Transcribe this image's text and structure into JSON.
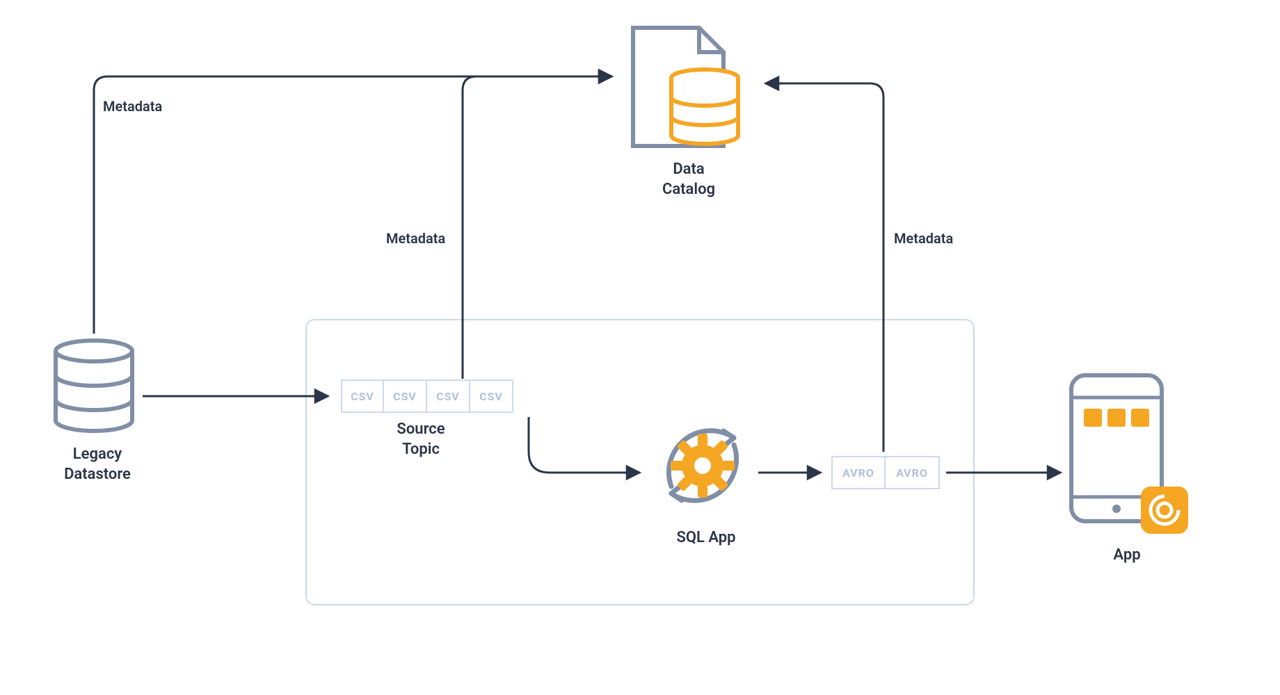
{
  "nodes": {
    "legacy_datastore": {
      "label_line1": "Legacy",
      "label_line2": "Datastore"
    },
    "data_catalog": {
      "label_line1": "Data",
      "label_line2": "Catalog"
    },
    "source_topic": {
      "label_line1": "Source",
      "label_line2": "Topic"
    },
    "sql_app": {
      "label": "SQL App"
    },
    "app": {
      "label": "App"
    }
  },
  "blocks": {
    "csv": {
      "cell": "CSV",
      "count": 4
    },
    "avro": {
      "cell": "AVRO",
      "count": 2
    }
  },
  "edge_labels": {
    "meta_left": "Metadata",
    "meta_mid": "Metadata",
    "meta_right": "Metadata"
  }
}
